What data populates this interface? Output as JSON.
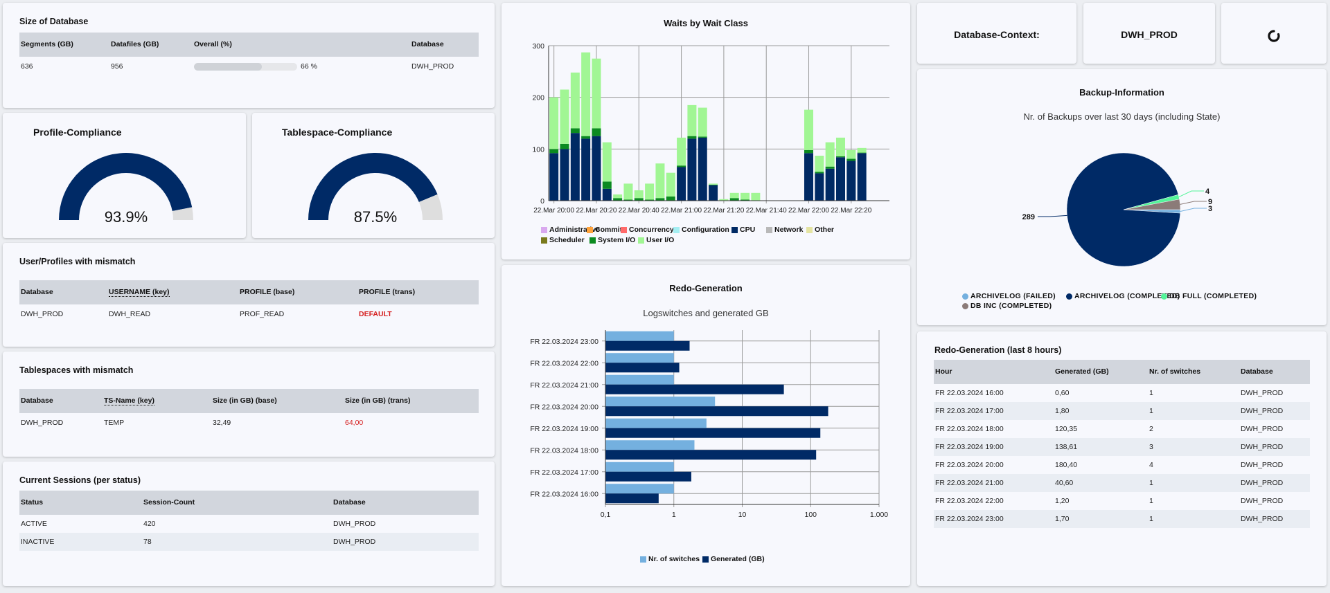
{
  "size_db": {
    "title": "Size of Database",
    "headers": [
      "Segments (GB)",
      "Datafiles (GB)",
      "Overall (%)",
      "Database"
    ],
    "row": {
      "segments": "636",
      "datafiles": "956",
      "overall_label": "66 %",
      "overall_pct": 66,
      "database": "DWH_PROD"
    }
  },
  "profile_compliance": {
    "title": "Profile-Compliance",
    "value_label": "93.9%",
    "value": 93.9,
    "color": "#002a66",
    "rest_color": "#dedede"
  },
  "tablespace_compliance": {
    "title": "Tablespace-Compliance",
    "value_label": "87.5%",
    "value": 87.5,
    "color": "#002a66",
    "rest_color": "#dedede"
  },
  "user_profiles": {
    "title": "User/Profiles with mismatch",
    "headers": [
      "Database",
      "USERNAME (key)",
      "PROFILE (base)",
      "PROFILE (trans)"
    ],
    "rows": [
      [
        "DWH_PROD",
        "DWH_READ",
        "PROF_READ",
        "DEFAULT"
      ]
    ]
  },
  "tablespaces": {
    "title": "Tablespaces with mismatch",
    "headers": [
      "Database",
      "TS-Name (key)",
      "Size (in GB) (base)",
      "Size (in GB) (trans)"
    ],
    "rows": [
      [
        "DWH_PROD",
        "TEMP",
        "32,49",
        "64,00"
      ]
    ]
  },
  "sessions": {
    "title": "Current Sessions (per status)",
    "headers": [
      "Status",
      "Session-Count",
      "Database"
    ],
    "rows": [
      [
        "ACTIVE",
        "420",
        "DWH_PROD"
      ],
      [
        "INACTIVE",
        "78",
        "DWH_PROD"
      ]
    ]
  },
  "context": {
    "label": "Database-Context:",
    "value": "DWH_PROD",
    "refresh_icon": "refresh-icon"
  },
  "redo_table": {
    "title": "Redo-Generation (last 8 hours)",
    "headers": [
      "Hour",
      "Generated (GB)",
      "Nr. of switches",
      "Database"
    ],
    "rows": [
      [
        "FR 22.03.2024 16:00",
        "0,60",
        "1",
        "DWH_PROD"
      ],
      [
        "FR 22.03.2024 17:00",
        "1,80",
        "1",
        "DWH_PROD"
      ],
      [
        "FR 22.03.2024 18:00",
        "120,35",
        "2",
        "DWH_PROD"
      ],
      [
        "FR 22.03.2024 19:00",
        "138,61",
        "3",
        "DWH_PROD"
      ],
      [
        "FR 22.03.2024 20:00",
        "180,40",
        "4",
        "DWH_PROD"
      ],
      [
        "FR 22.03.2024 21:00",
        "40,60",
        "1",
        "DWH_PROD"
      ],
      [
        "FR 22.03.2024 22:00",
        "1,20",
        "1",
        "DWH_PROD"
      ],
      [
        "FR 22.03.2024 23:00",
        "1,70",
        "1",
        "DWH_PROD"
      ]
    ]
  },
  "chart_data": [
    {
      "type": "bar",
      "stacked": true,
      "title": "Waits by Wait Class",
      "xlabel": "",
      "ylabel": "",
      "ylim": [
        0,
        300
      ],
      "yticks": [
        "0",
        "100",
        "200",
        "300"
      ],
      "xticks": [
        "22.Mar 20:00",
        "22.Mar 20:20",
        "22.Mar 20:40",
        "22.Mar 21:00",
        "22.Mar 21:20",
        "22.Mar 21:40",
        "22.Mar 22:00",
        "22.Mar 22:20"
      ],
      "grid": true,
      "legend_position": "bottom",
      "legend": [
        {
          "name": "Administrative",
          "color": "#d9a9ef"
        },
        {
          "name": "Commit",
          "color": "#ffa33c"
        },
        {
          "name": "Concurrency",
          "color": "#ff6a6a"
        },
        {
          "name": "Configuration",
          "color": "#a4eef2"
        },
        {
          "name": "CPU",
          "color": "#002a64"
        },
        {
          "name": "Network",
          "color": "#b9b9b9"
        },
        {
          "name": "Other",
          "color": "#e4e4a2"
        },
        {
          "name": "Scheduler",
          "color": "#7a7a1d"
        },
        {
          "name": "System I/O",
          "color": "#0b8a20"
        },
        {
          "name": "User I/O",
          "color": "#a1f694"
        }
      ],
      "x": [
        "20:00",
        "20:05",
        "20:10",
        "20:15",
        "20:20",
        "20:25",
        "20:30",
        "20:35",
        "20:40",
        "20:45",
        "20:50",
        "20:55",
        "21:00",
        "21:05",
        "21:10",
        "21:15",
        "21:20",
        "21:25",
        "21:30",
        "21:35",
        "22:00",
        "22:05",
        "22:10",
        "22:15",
        "22:20",
        "22:25"
      ],
      "series": [
        {
          "name": "CPU",
          "color": "#002a64",
          "values": [
            92,
            100,
            131,
            120,
            125,
            23,
            0,
            0,
            0,
            0,
            0,
            0,
            65,
            120,
            122,
            30,
            0,
            0,
            0,
            0,
            92,
            53,
            62,
            84,
            77,
            92
          ]
        },
        {
          "name": "System I/O",
          "color": "#0b8a20",
          "values": [
            8,
            10,
            9,
            5,
            15,
            14,
            5,
            2,
            5,
            2,
            5,
            8,
            3,
            5,
            2,
            1,
            0,
            5,
            2,
            0,
            6,
            3,
            4,
            2,
            4,
            1
          ]
        },
        {
          "name": "User I/O",
          "color": "#a1f694",
          "values": [
            100,
            105,
            108,
            162,
            135,
            76,
            7,
            31,
            15,
            31,
            67,
            46,
            54,
            60,
            56,
            2,
            3,
            10,
            13,
            15,
            78,
            31,
            47,
            36,
            17,
            9
          ]
        }
      ]
    },
    {
      "type": "bar",
      "orientation": "horizontal",
      "title": "Redo-Generation",
      "subtitle": "Logswitches and generated GB",
      "x_scale": "log",
      "xlim": [
        0.1,
        1000
      ],
      "xticks": [
        "0,1",
        "1",
        "10",
        "100",
        "1.000"
      ],
      "grid": true,
      "legend_position": "bottom",
      "categories": [
        "FR 22.03.2024 23:00",
        "FR 22.03.2024 22:00",
        "FR 22.03.2024 21:00",
        "FR 22.03.2024 20:00",
        "FR 22.03.2024 19:00",
        "FR 22.03.2024 18:00",
        "FR 22.03.2024 17:00",
        "FR 22.03.2024 16:00"
      ],
      "series": [
        {
          "name": "Nr. of switches",
          "color": "#74b0df",
          "values": [
            1,
            1,
            1,
            4,
            3,
            2,
            1,
            1
          ]
        },
        {
          "name": "Generated (GB)",
          "color": "#002a66",
          "values": [
            1.7,
            1.2,
            40.6,
            180.4,
            138.61,
            120.35,
            1.8,
            0.6
          ]
        }
      ]
    },
    {
      "type": "pie",
      "title": "Backup-Information",
      "subtitle": "Nr. of Backups over last 30 days (including State)",
      "legend_position": "bottom",
      "slices": [
        {
          "name": "ARCHIVELOG (FAILED)",
          "value": 3,
          "label": "3",
          "color": "#74b0df"
        },
        {
          "name": "ARCHIVELOG (COMPLETED)",
          "value": 289,
          "label": "289",
          "color": "#002a66"
        },
        {
          "name": "DB FULL (COMPLETED)",
          "value": 4,
          "label": "4",
          "color": "#54f59a"
        },
        {
          "name": "DB INC (COMPLETED)",
          "value": 9,
          "label": "9",
          "color": "#8b7b78"
        }
      ]
    }
  ]
}
